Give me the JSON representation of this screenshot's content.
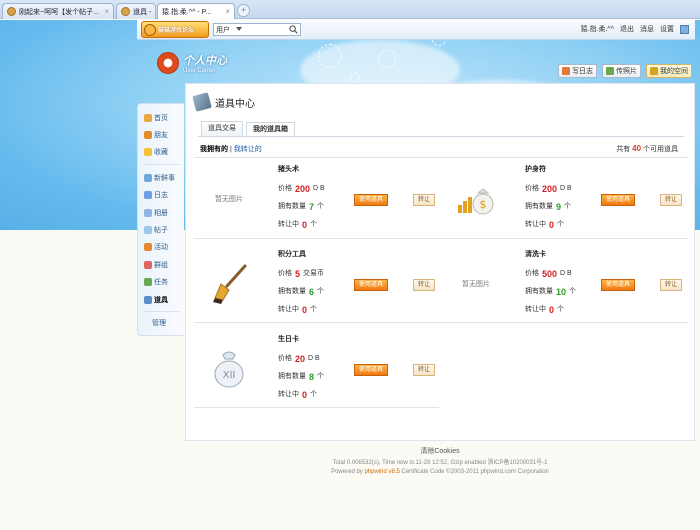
{
  "browser": {
    "tabs": [
      {
        "title": "刚起来~呵呵【发个帖子...",
        "close": "×"
      },
      {
        "title": "道具 -",
        "close": ""
      },
      {
        "title": "猿.指.柔.^^ - P...",
        "close": "×"
      }
    ],
    "new_tab": "+"
  },
  "topbar": {
    "logo_text": "猫猫游戏论坛",
    "search_scope": "用户",
    "username": "猿.指.柔.^^",
    "links": [
      "退出",
      "消息",
      "设置"
    ]
  },
  "user_center": {
    "cn": "个人中心",
    "en": "User Center"
  },
  "actions": [
    {
      "label": "写日志",
      "icon": "pencil-icon",
      "color": "#e07b3c"
    },
    {
      "label": "传照片",
      "icon": "photo-icon",
      "color": "#6aa84f"
    },
    {
      "label": "我的空间",
      "icon": "home-icon",
      "color": "#d7a21f"
    }
  ],
  "sidebar": {
    "groups": [
      [
        {
          "label": "首页",
          "icon": "home-icon",
          "color": "#e9a63a"
        },
        {
          "label": "朋友",
          "icon": "friends-icon",
          "color": "#e58b2e"
        },
        {
          "label": "收藏",
          "icon": "star-icon",
          "color": "#f1c232"
        }
      ],
      [
        {
          "label": "新鲜事",
          "icon": "bubble-icon",
          "color": "#6fa8dc"
        },
        {
          "label": "日志",
          "icon": "diary-icon",
          "color": "#6d9eeb"
        },
        {
          "label": "相册",
          "icon": "album-icon",
          "color": "#8db4e2"
        },
        {
          "label": "帖子",
          "icon": "post-icon",
          "color": "#9fc5e8"
        },
        {
          "label": "活动",
          "icon": "event-icon",
          "color": "#e58b2e"
        },
        {
          "label": "群组",
          "icon": "group-icon",
          "color": "#e06666"
        },
        {
          "label": "任务",
          "icon": "task-icon",
          "color": "#6aa84f"
        },
        {
          "label": "道具",
          "icon": "tool-icon",
          "color": "#5b8dc9"
        }
      ]
    ],
    "manage": "管理"
  },
  "panel": {
    "title": "道具中心",
    "tabs": [
      {
        "label": "道具交易",
        "active": false
      },
      {
        "label": "我的道具箱",
        "active": true
      }
    ],
    "filter": {
      "own": "我拥有的",
      "sep": "|",
      "transfer": "我转让的"
    },
    "total": {
      "prefix": "共有",
      "count": "40",
      "suffix": "个可用道具"
    }
  },
  "labels": {
    "price": "价格",
    "have": "拥有数量",
    "transferring": "转让中",
    "unit": "个",
    "use_btn": "使用道具",
    "transfer_btn": "转让",
    "no_image": "暂无图片"
  },
  "items": [
    {
      "name": "猪头术",
      "price": "200",
      "currency": "D B",
      "qty": "7",
      "transfer": "0",
      "image": "no-image"
    },
    {
      "name": "护身符",
      "price": "200",
      "currency": "D B",
      "qty": "9",
      "transfer": "0",
      "image": "money-bag-icon"
    },
    {
      "name": "积分工具",
      "price": "5",
      "currency": "交易币",
      "qty": "6",
      "transfer": "0",
      "image": "brush-icon"
    },
    {
      "name": "清洗卡",
      "price": "500",
      "currency": "D B",
      "qty": "10",
      "transfer": "0",
      "image": "no-image"
    },
    {
      "name": "生日卡",
      "price": "20",
      "currency": "D B",
      "qty": "8",
      "transfer": "0",
      "image": "gift-bag-icon"
    }
  ],
  "footer": {
    "cookie": "清除Cookies",
    "line1": "Total 0.006532(s), Time now is:11-28 12:52, Gzip enabled 浙ICP备10200031号-1",
    "line2_pre": "Powered by",
    "line2_brand": "phpwind v8.5",
    "line2_post": "Certificate Code ©2003-2011 phpwind.com Corporation"
  }
}
